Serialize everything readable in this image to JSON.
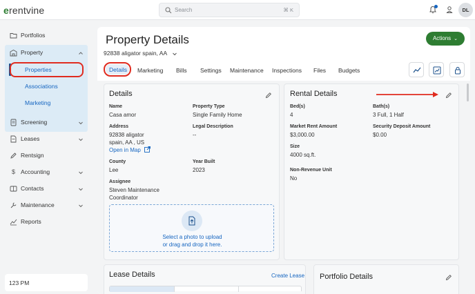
{
  "app": {
    "logo_text": "rentvine"
  },
  "topbar": {
    "search_placeholder": "Search",
    "search_shortcut": "⌘ K",
    "avatar_initials": "DL"
  },
  "sidebar": {
    "items": [
      {
        "label": "Portfolios",
        "icon": "folder-icon"
      },
      {
        "label": "Property",
        "icon": "building-icon",
        "expanded": true
      },
      {
        "label": "Screening",
        "icon": "screening-icon"
      },
      {
        "label": "Leases",
        "icon": "leases-icon"
      },
      {
        "label": "Rentsign",
        "icon": "pen-icon"
      },
      {
        "label": "Accounting",
        "icon": "dollar-icon"
      },
      {
        "label": "Contacts",
        "icon": "contacts-icon"
      },
      {
        "label": "Maintenance",
        "icon": "wrench-icon"
      },
      {
        "label": "Reports",
        "icon": "reports-icon"
      }
    ],
    "property_sub": [
      "Properties",
      "Associations",
      "Marketing"
    ],
    "active_sub": "Properties",
    "footer_time": "123 PM"
  },
  "page": {
    "title": "Property Details",
    "address": "92838 aligator spain, AA",
    "actions_label": "Actions",
    "tabs": [
      "Details",
      "Marketing",
      "Bills",
      "Settings",
      "Maintenance",
      "Inspections",
      "Files",
      "Budgets"
    ],
    "active_tab": "Details"
  },
  "details": {
    "heading": "Details",
    "name_label": "Name",
    "name_value": "Casa amor",
    "property_type_label": "Property Type",
    "property_type_value": "Single Family Home",
    "address_label": "Address",
    "address_line1": "92838 aligator",
    "address_line2": "spain, AA , US",
    "open_map_label": "Open in Map",
    "legal_label": "Legal Description",
    "legal_value": "--",
    "county_label": "County",
    "county_value": "Lee",
    "year_label": "Year Built",
    "year_value": "2023",
    "assignee_label": "Assignee",
    "assignee_line1": "Steven Maintenance",
    "assignee_line2": "Coordinator",
    "upload_line1": "Select a photo to upload",
    "upload_line2": "or drag and drop it here."
  },
  "rental": {
    "heading": "Rental Details",
    "beds_label": "Bed(s)",
    "beds_value": "4",
    "baths_label": "Bath(s)",
    "baths_value": "3 Full, 1 Half",
    "market_rent_label": "Market Rent Amount",
    "market_rent_value": "$3,000.00",
    "deposit_label": "Security Deposit Amount",
    "deposit_value": "$0.00",
    "size_label": "Size",
    "size_value": "4000 sq.ft.",
    "nonrev_label": "Non-Revenue Unit",
    "nonrev_value": "No"
  },
  "lease": {
    "heading": "Lease Details",
    "create_label": "Create Lease"
  },
  "portfolio": {
    "heading": "Portfolio Details"
  },
  "colors": {
    "brand_green": "#2e7d32",
    "link_blue": "#1565c0",
    "annotation_red": "#e02b1f",
    "sidebar_active_bg": "#dcebf6"
  }
}
